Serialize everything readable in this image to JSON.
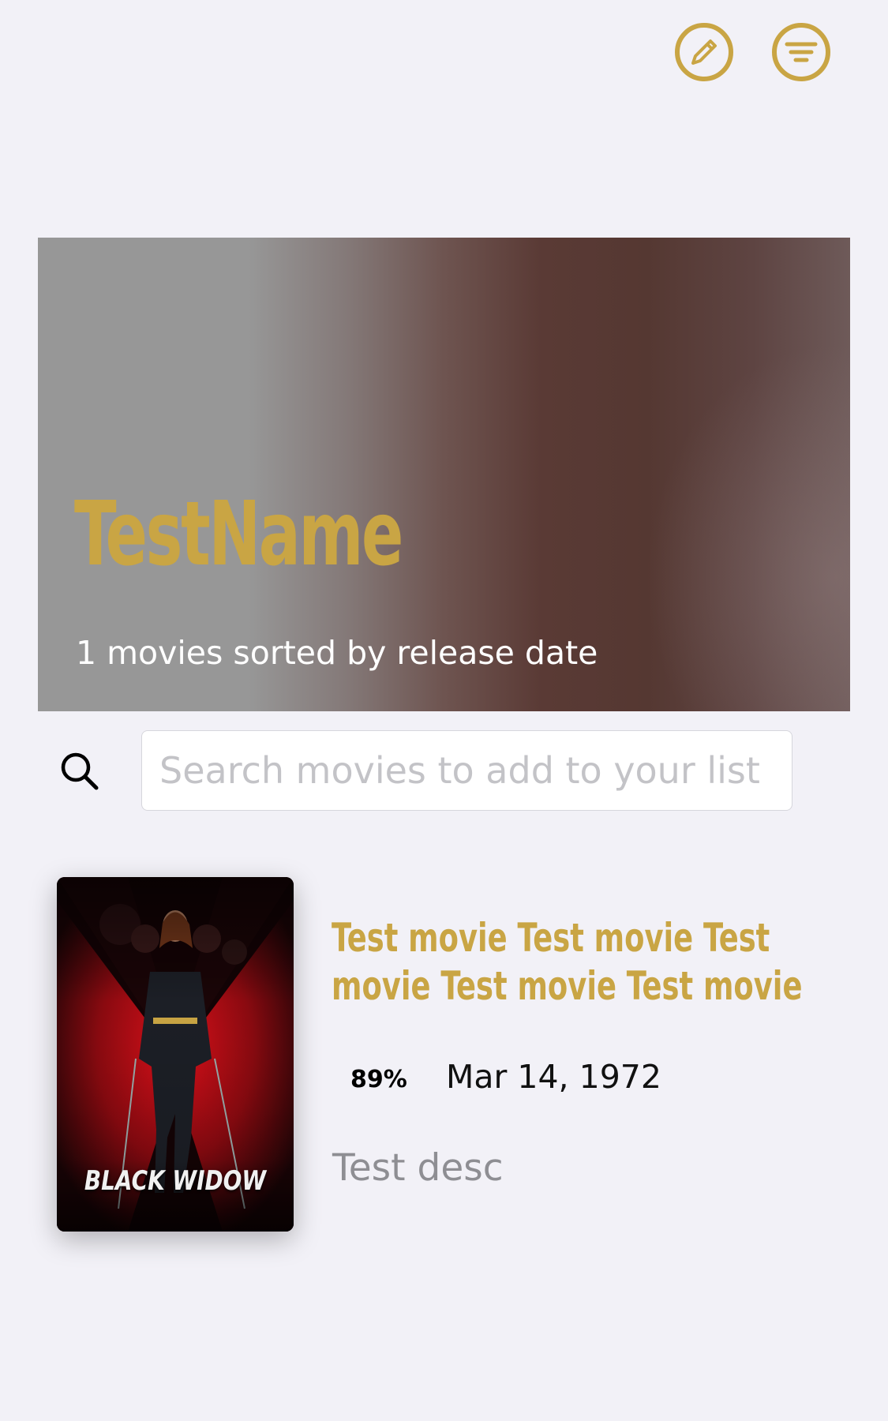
{
  "toolbar": {
    "edit_icon": "pencil-circle-icon",
    "filter_icon": "filter-lines-circle-icon",
    "accent_color": "#c9a544"
  },
  "header": {
    "title": "TestName",
    "subtitle": "1 movies sorted by release date"
  },
  "search": {
    "icon": "search-icon",
    "placeholder": "Search movies to add to your list",
    "value": ""
  },
  "movies": [
    {
      "poster_text": "BLACK WIDOW",
      "title": "Test movie Test movie Test movie Test movie Test movie Test movi...",
      "rating": "89%",
      "release_date": "Mar 14, 1972",
      "description": "Test desc"
    }
  ]
}
